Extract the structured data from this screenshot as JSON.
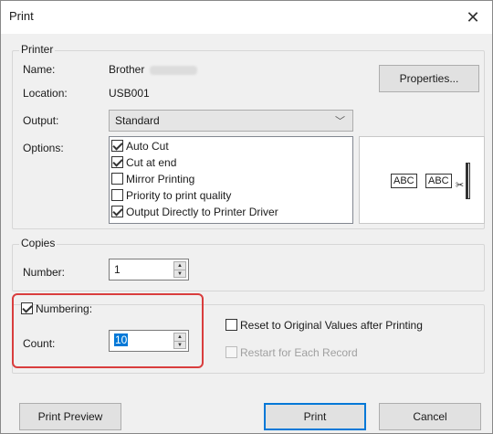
{
  "window": {
    "title": "Print",
    "close": "✕"
  },
  "printer_group": {
    "title": "Printer",
    "name_label": "Name:",
    "name_value": "Brother",
    "location_label": "Location:",
    "location_value": "USB001",
    "properties_button": "Properties...",
    "output_label": "Output:",
    "output_value": "Standard",
    "options_label": "Options:",
    "options": [
      {
        "label": "Auto Cut",
        "checked": true
      },
      {
        "label": "Cut at end",
        "checked": true
      },
      {
        "label": "Mirror Printing",
        "checked": false
      },
      {
        "label": "Priority to print quality",
        "checked": false
      },
      {
        "label": "Output Directly to Printer Driver",
        "checked": true
      }
    ],
    "preview_labels": [
      "ABC",
      "ABC"
    ]
  },
  "copies_group": {
    "title": "Copies",
    "number_label": "Number:",
    "number_value": "1"
  },
  "numbering": {
    "checkbox_label": "Numbering:",
    "checked": true,
    "count_label": "Count:",
    "count_value": "10",
    "reset_label": "Reset to Original Values after Printing",
    "reset_checked": false,
    "restart_label": "Restart for Each Record",
    "restart_enabled": false
  },
  "buttons": {
    "print_preview": "Print Preview",
    "print": "Print",
    "cancel": "Cancel"
  },
  "colors": {
    "highlight": "#d93d3d",
    "default_button_border": "#0078d7"
  }
}
